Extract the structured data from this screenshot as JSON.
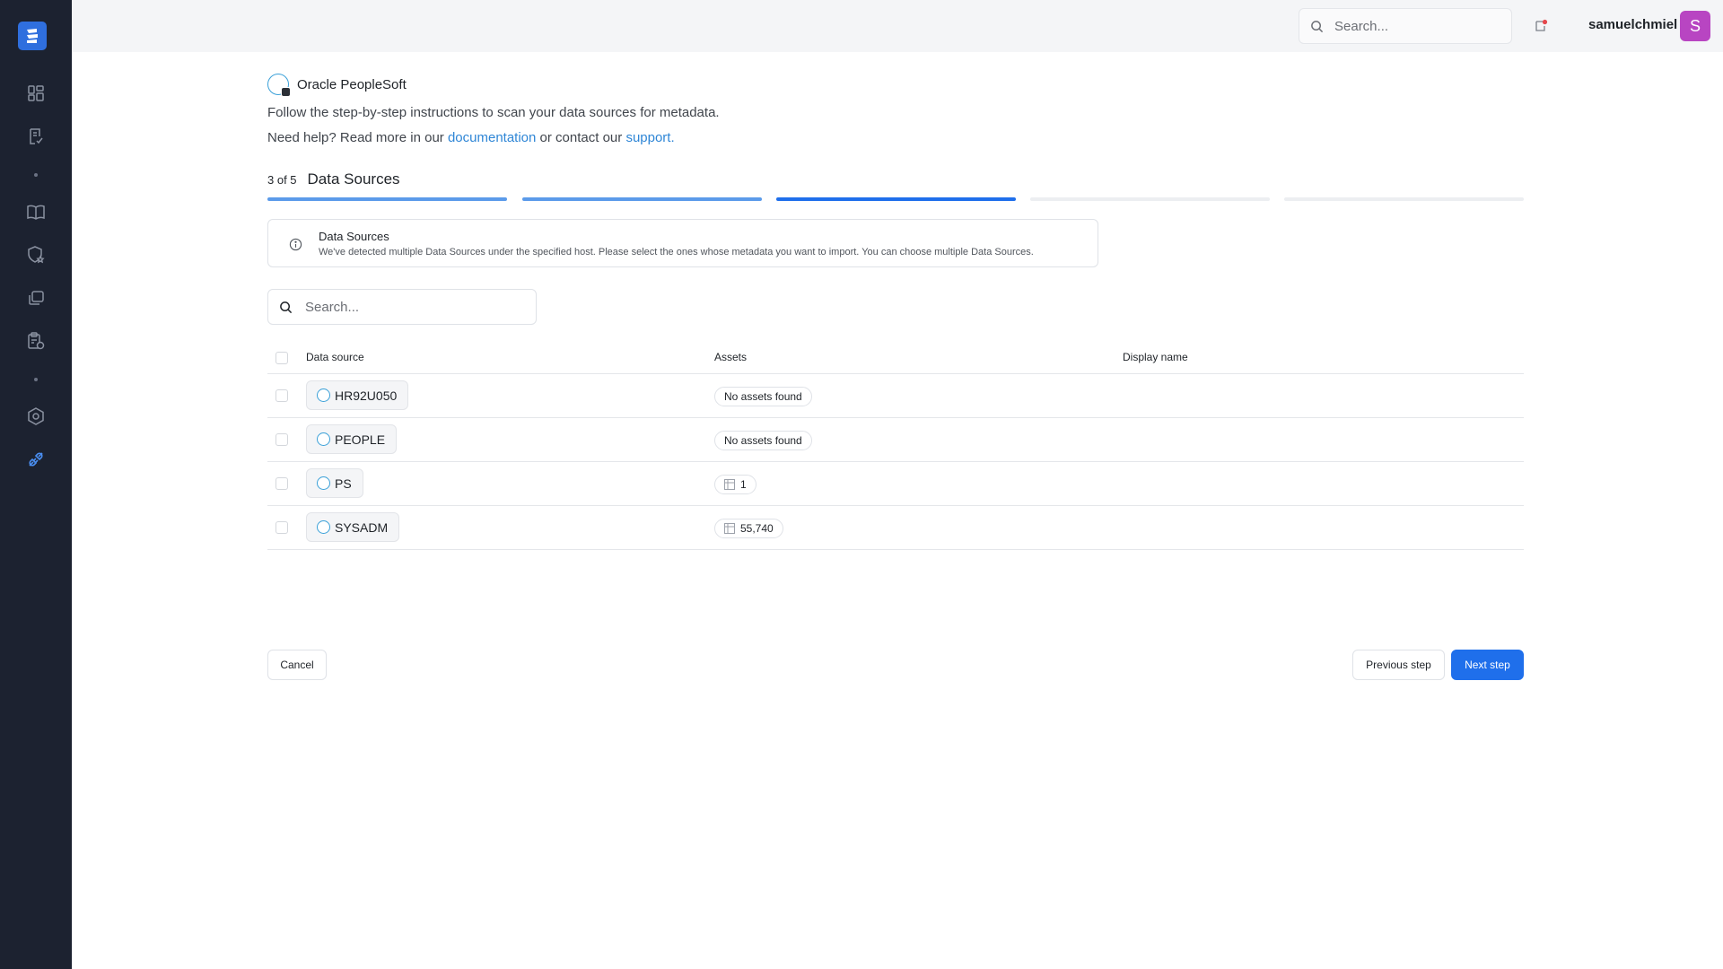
{
  "sidebar": {
    "logo_icon": "brand-logo-icon",
    "items": [
      {
        "icon": "dashboard-icon"
      },
      {
        "icon": "checklist-icon"
      },
      {
        "icon": "book-icon"
      },
      {
        "icon": "shield-star-icon"
      },
      {
        "icon": "copy-icon"
      },
      {
        "icon": "clipboard-settings-icon"
      },
      {
        "icon": "hexagon-settings-icon"
      },
      {
        "icon": "connector-icon",
        "active": true
      }
    ]
  },
  "topbar": {
    "search_placeholder": "Search...",
    "username": "samuelchmiel",
    "avatar_letter": "S",
    "avatar_color": "#b845c2"
  },
  "header": {
    "source_title": "Oracle PeopleSoft",
    "intro": "Follow the step-by-step instructions to scan your data sources for metadata.",
    "help_prefix": "Need help? Read more in our",
    "help_doc_link": "documentation",
    "help_middle": "or contact our",
    "help_support_link": "support."
  },
  "step": {
    "count": "3 of 5",
    "name": "Data Sources",
    "segments": [
      {
        "state": "complete",
        "color": "#5b9bea"
      },
      {
        "state": "complete",
        "color": "#5b9bea"
      },
      {
        "state": "current",
        "color": "#1f6feb"
      },
      {
        "state": "pending",
        "color": "#eceef1"
      },
      {
        "state": "pending",
        "color": "#eceef1"
      }
    ]
  },
  "info": {
    "title": "Data Sources",
    "text": "We've detected multiple Data Sources under the specified host. Please select the ones whose metadata you want to import. You can choose multiple Data Sources."
  },
  "table_search": {
    "placeholder": "Search..."
  },
  "table": {
    "columns": [
      "Data source",
      "Assets",
      "Display name"
    ],
    "rows": [
      {
        "name": "HR92U050",
        "assets": "No assets found",
        "has_icon": false,
        "display_name": ""
      },
      {
        "name": "PEOPLE",
        "assets": "No assets found",
        "has_icon": false,
        "display_name": ""
      },
      {
        "name": "PS",
        "assets": "1",
        "has_icon": true,
        "display_name": ""
      },
      {
        "name": "SYSADM",
        "assets": "55,740",
        "has_icon": true,
        "display_name": ""
      }
    ]
  },
  "footer": {
    "cancel": "Cancel",
    "previous": "Previous step",
    "next": "Next step",
    "accent_color": "#1f6feb"
  }
}
